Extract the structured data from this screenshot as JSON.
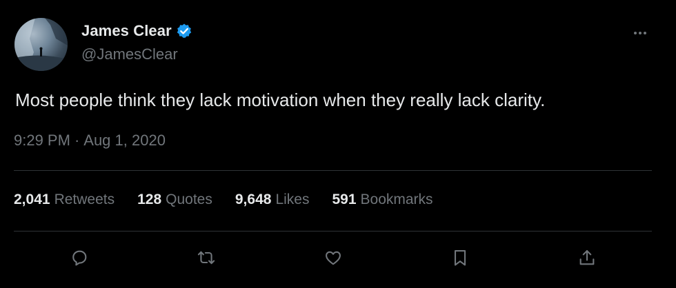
{
  "author": {
    "display_name": "James Clear",
    "handle": "@JamesClear",
    "verified": true
  },
  "tweet": {
    "text": "Most people think they lack motivation when they really lack clarity.",
    "time": "9:29 PM",
    "separator": "·",
    "date": "Aug 1, 2020"
  },
  "stats": [
    {
      "count": "2,041",
      "label": "Retweets"
    },
    {
      "count": "128",
      "label": "Quotes"
    },
    {
      "count": "9,648",
      "label": "Likes"
    },
    {
      "count": "591",
      "label": "Bookmarks"
    }
  ],
  "actions": [
    "reply-icon",
    "retweet-icon",
    "like-icon",
    "bookmark-icon",
    "share-icon"
  ],
  "icons": {
    "more": "more-horizontal-icon",
    "verified": "verified-badge-icon"
  },
  "colors": {
    "background": "#000000",
    "text": "#e7e9ea",
    "secondary_text": "#71767b",
    "divider": "#2f3336",
    "verified_blue": "#1d9bf0"
  }
}
